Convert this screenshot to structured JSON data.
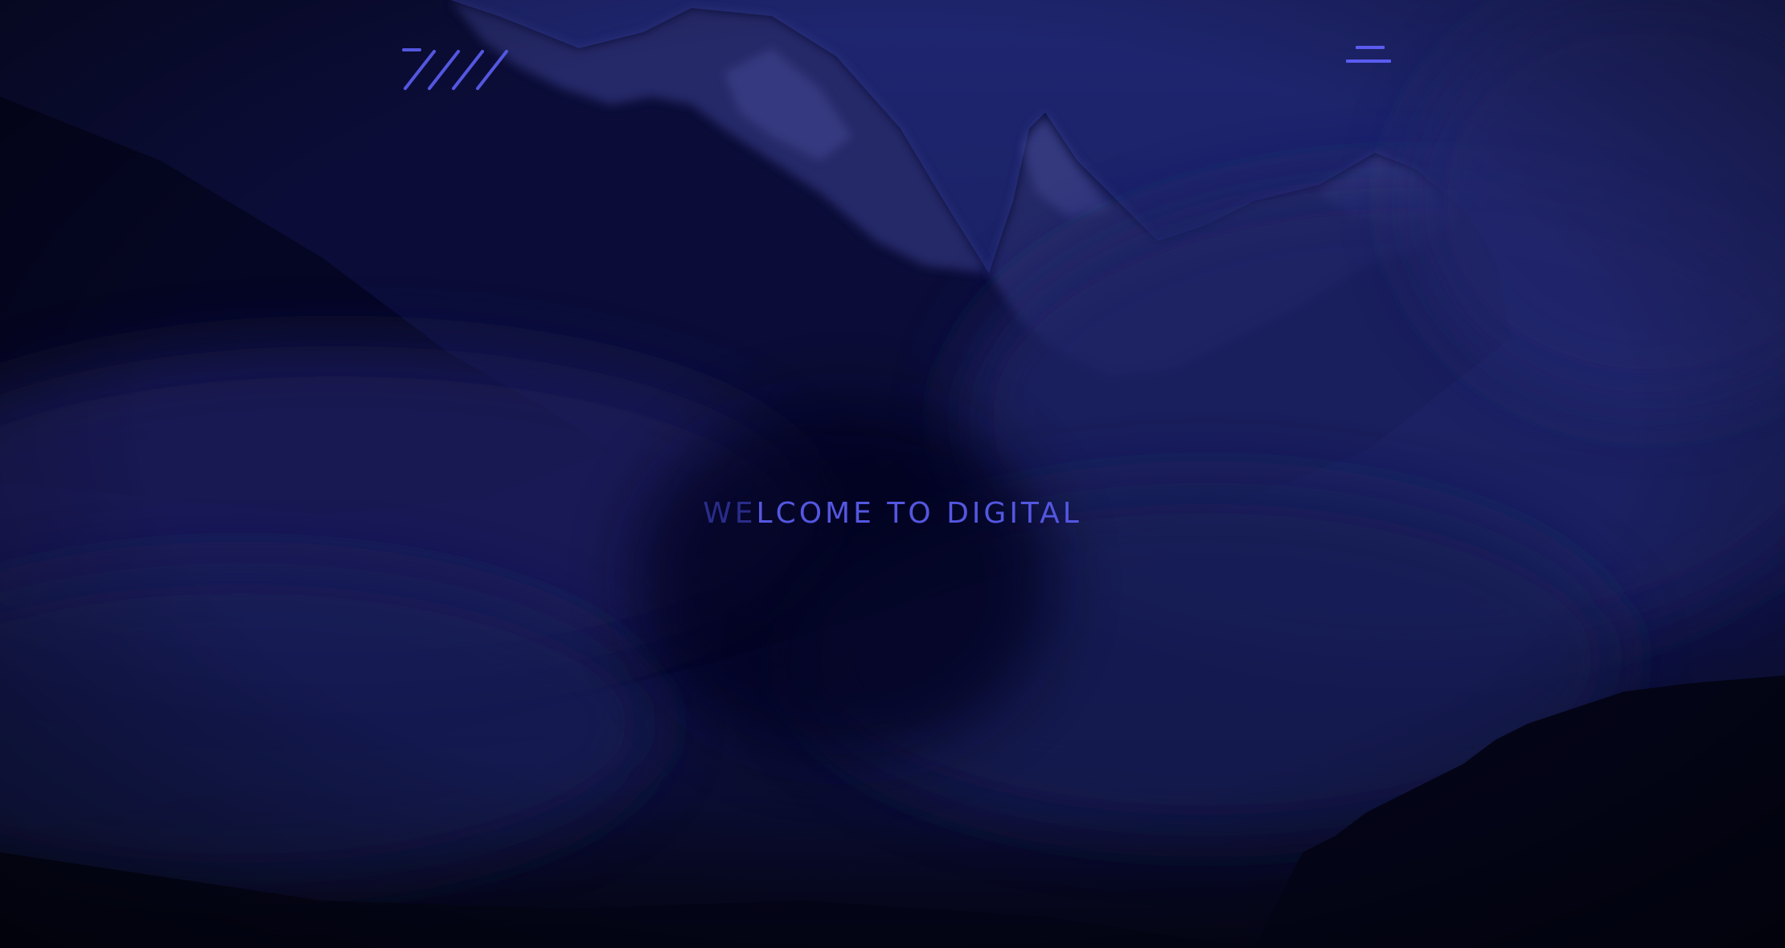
{
  "hero": {
    "headline_faded": "WE",
    "headline_main": "LCOME TO DIGITAL"
  },
  "icons": {
    "logo": "slash-logo-icon",
    "menu": "hamburger-menu-icon"
  },
  "colors": {
    "accent": "#5457e0",
    "sky": "#1f2670",
    "shadow": "#05061a"
  }
}
